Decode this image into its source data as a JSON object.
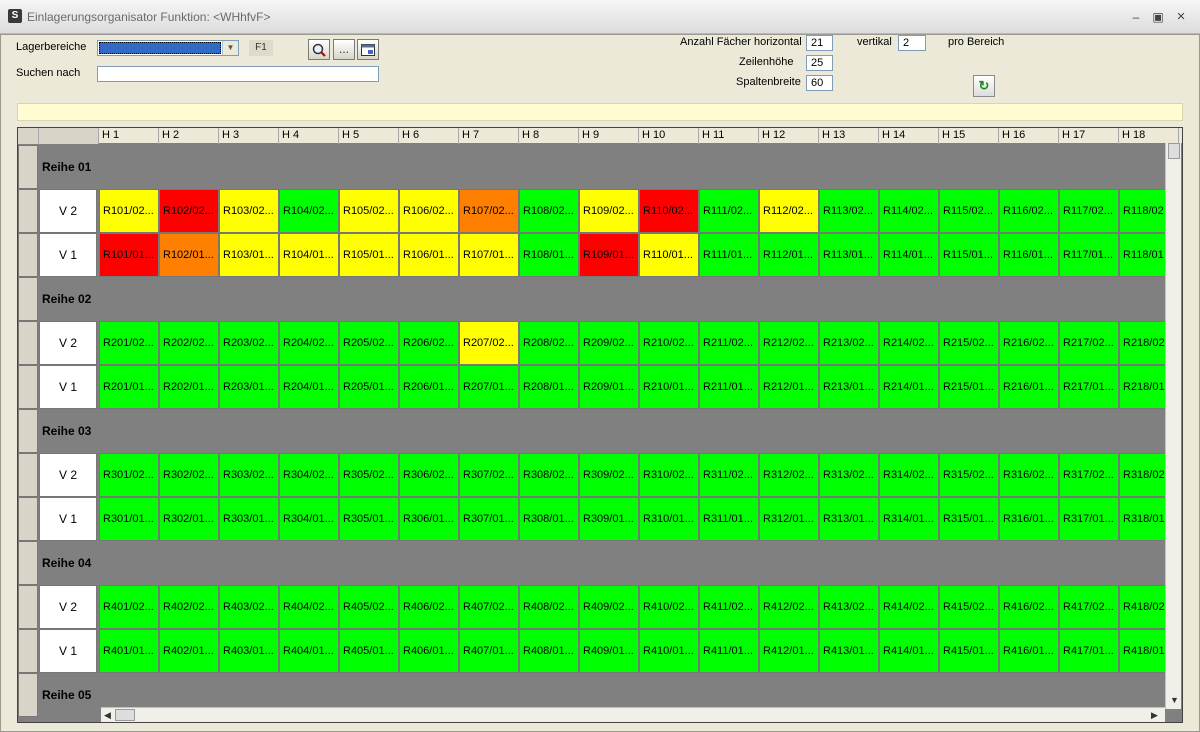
{
  "window": {
    "title": "Einlagerungsorganisator Funktion: <WHhfvF>",
    "app_icon": "S"
  },
  "toolbar": {
    "lagerbereiche_label": "Lagerbereiche",
    "lagerbereiche_value": "",
    "f1_label": "F1",
    "suchen_label": "Suchen nach",
    "suchen_value": "",
    "dots_label": "...",
    "anzahl_horizontal_label": "Anzahl Fächer horizontal",
    "anzahl_horizontal_value": "21",
    "vertikal_label": "vertikal",
    "vertikal_value": "2",
    "pro_bereich_label": "pro Bereich",
    "zeilenhoehe_label": "Zeilenhöhe",
    "zeilenhoehe_value": "25",
    "spaltenbreite_label": "Spaltenbreite",
    "spaltenbreite_value": "60"
  },
  "message_bar": "",
  "grid": {
    "columns": [
      "H 1",
      "H 2",
      "H 3",
      "H 4",
      "H 5",
      "H 6",
      "H 7",
      "H 8",
      "H 9",
      "H 10",
      "H 11",
      "H 12",
      "H 13",
      "H 14",
      "H 15",
      "H 16",
      "H 17",
      "H 18"
    ],
    "colors": {
      "green": "#00ff00",
      "yellow": "#ffff00",
      "red": "#ff0000",
      "orange": "#ff8000"
    },
    "sections": [
      {
        "label": "Reihe 01",
        "rows": [
          {
            "label": "V 2",
            "cells": [
              {
                "text": "R101/02...",
                "status": "yellow"
              },
              {
                "text": "R102/02...",
                "status": "red"
              },
              {
                "text": "R103/02...",
                "status": "yellow"
              },
              {
                "text": "R104/02...",
                "status": "green"
              },
              {
                "text": "R105/02...",
                "status": "yellow"
              },
              {
                "text": "R106/02...",
                "status": "yellow"
              },
              {
                "text": "R107/02...",
                "status": "orange"
              },
              {
                "text": "R108/02...",
                "status": "green"
              },
              {
                "text": "R109/02...",
                "status": "yellow"
              },
              {
                "text": "R110/02...",
                "status": "red"
              },
              {
                "text": "R111/02...",
                "status": "green"
              },
              {
                "text": "R112/02...",
                "status": "yellow"
              },
              {
                "text": "R113/02...",
                "status": "green"
              },
              {
                "text": "R114/02...",
                "status": "green"
              },
              {
                "text": "R115/02...",
                "status": "green"
              },
              {
                "text": "R116/02...",
                "status": "green"
              },
              {
                "text": "R117/02...",
                "status": "green"
              },
              {
                "text": "R118/02",
                "status": "green"
              }
            ]
          },
          {
            "label": "V 1",
            "cells": [
              {
                "text": "R101/01...",
                "status": "red"
              },
              {
                "text": "R102/01...",
                "status": "orange"
              },
              {
                "text": "R103/01...",
                "status": "yellow"
              },
              {
                "text": "R104/01...",
                "status": "yellow"
              },
              {
                "text": "R105/01...",
                "status": "yellow"
              },
              {
                "text": "R106/01...",
                "status": "yellow"
              },
              {
                "text": "R107/01...",
                "status": "yellow"
              },
              {
                "text": "R108/01...",
                "status": "green"
              },
              {
                "text": "R109/01...",
                "status": "red"
              },
              {
                "text": "R110/01...",
                "status": "yellow"
              },
              {
                "text": "R111/01...",
                "status": "green"
              },
              {
                "text": "R112/01...",
                "status": "green"
              },
              {
                "text": "R113/01...",
                "status": "green"
              },
              {
                "text": "R114/01...",
                "status": "green"
              },
              {
                "text": "R115/01...",
                "status": "green"
              },
              {
                "text": "R116/01...",
                "status": "green"
              },
              {
                "text": "R117/01...",
                "status": "green"
              },
              {
                "text": "R118/01",
                "status": "green"
              }
            ]
          }
        ]
      },
      {
        "label": "Reihe 02",
        "rows": [
          {
            "label": "V 2",
            "cells": [
              {
                "text": "R201/02...",
                "status": "green"
              },
              {
                "text": "R202/02...",
                "status": "green"
              },
              {
                "text": "R203/02...",
                "status": "green"
              },
              {
                "text": "R204/02...",
                "status": "green"
              },
              {
                "text": "R205/02...",
                "status": "green"
              },
              {
                "text": "R206/02...",
                "status": "green"
              },
              {
                "text": "R207/02...",
                "status": "yellow"
              },
              {
                "text": "R208/02...",
                "status": "green"
              },
              {
                "text": "R209/02...",
                "status": "green"
              },
              {
                "text": "R210/02...",
                "status": "green"
              },
              {
                "text": "R211/02...",
                "status": "green"
              },
              {
                "text": "R212/02...",
                "status": "green"
              },
              {
                "text": "R213/02...",
                "status": "green"
              },
              {
                "text": "R214/02...",
                "status": "green"
              },
              {
                "text": "R215/02...",
                "status": "green"
              },
              {
                "text": "R216/02...",
                "status": "green"
              },
              {
                "text": "R217/02...",
                "status": "green"
              },
              {
                "text": "R218/02",
                "status": "green"
              }
            ]
          },
          {
            "label": "V 1",
            "cells": [
              {
                "text": "R201/01...",
                "status": "green"
              },
              {
                "text": "R202/01...",
                "status": "green"
              },
              {
                "text": "R203/01...",
                "status": "green"
              },
              {
                "text": "R204/01...",
                "status": "green"
              },
              {
                "text": "R205/01...",
                "status": "green"
              },
              {
                "text": "R206/01...",
                "status": "green"
              },
              {
                "text": "R207/01...",
                "status": "green"
              },
              {
                "text": "R208/01...",
                "status": "green"
              },
              {
                "text": "R209/01...",
                "status": "green"
              },
              {
                "text": "R210/01...",
                "status": "green"
              },
              {
                "text": "R211/01...",
                "status": "green"
              },
              {
                "text": "R212/01...",
                "status": "green"
              },
              {
                "text": "R213/01...",
                "status": "green"
              },
              {
                "text": "R214/01...",
                "status": "green"
              },
              {
                "text": "R215/01...",
                "status": "green"
              },
              {
                "text": "R216/01...",
                "status": "green"
              },
              {
                "text": "R217/01...",
                "status": "green"
              },
              {
                "text": "R218/01",
                "status": "green"
              }
            ]
          }
        ]
      },
      {
        "label": "Reihe 03",
        "rows": [
          {
            "label": "V 2",
            "cells": [
              {
                "text": "R301/02...",
                "status": "green"
              },
              {
                "text": "R302/02...",
                "status": "green"
              },
              {
                "text": "R303/02...",
                "status": "green"
              },
              {
                "text": "R304/02...",
                "status": "green"
              },
              {
                "text": "R305/02...",
                "status": "green"
              },
              {
                "text": "R306/02...",
                "status": "green"
              },
              {
                "text": "R307/02...",
                "status": "green"
              },
              {
                "text": "R308/02...",
                "status": "green"
              },
              {
                "text": "R309/02...",
                "status": "green"
              },
              {
                "text": "R310/02...",
                "status": "green"
              },
              {
                "text": "R311/02...",
                "status": "green"
              },
              {
                "text": "R312/02...",
                "status": "green"
              },
              {
                "text": "R313/02...",
                "status": "green"
              },
              {
                "text": "R314/02...",
                "status": "green"
              },
              {
                "text": "R315/02...",
                "status": "green"
              },
              {
                "text": "R316/02...",
                "status": "green"
              },
              {
                "text": "R317/02...",
                "status": "green"
              },
              {
                "text": "R318/02",
                "status": "green"
              }
            ]
          },
          {
            "label": "V 1",
            "cells": [
              {
                "text": "R301/01...",
                "status": "green"
              },
              {
                "text": "R302/01...",
                "status": "green"
              },
              {
                "text": "R303/01...",
                "status": "green"
              },
              {
                "text": "R304/01...",
                "status": "green"
              },
              {
                "text": "R305/01...",
                "status": "green"
              },
              {
                "text": "R306/01...",
                "status": "green"
              },
              {
                "text": "R307/01...",
                "status": "green"
              },
              {
                "text": "R308/01...",
                "status": "green"
              },
              {
                "text": "R309/01...",
                "status": "green"
              },
              {
                "text": "R310/01...",
                "status": "green"
              },
              {
                "text": "R311/01...",
                "status": "green"
              },
              {
                "text": "R312/01...",
                "status": "green"
              },
              {
                "text": "R313/01...",
                "status": "green"
              },
              {
                "text": "R314/01...",
                "status": "green"
              },
              {
                "text": "R315/01...",
                "status": "green"
              },
              {
                "text": "R316/01...",
                "status": "green"
              },
              {
                "text": "R317/01...",
                "status": "green"
              },
              {
                "text": "R318/01",
                "status": "green"
              }
            ]
          }
        ]
      },
      {
        "label": "Reihe 04",
        "rows": [
          {
            "label": "V 2",
            "cells": [
              {
                "text": "R401/02...",
                "status": "green"
              },
              {
                "text": "R402/02...",
                "status": "green"
              },
              {
                "text": "R403/02...",
                "status": "green"
              },
              {
                "text": "R404/02...",
                "status": "green"
              },
              {
                "text": "R405/02...",
                "status": "green"
              },
              {
                "text": "R406/02...",
                "status": "green"
              },
              {
                "text": "R407/02...",
                "status": "green"
              },
              {
                "text": "R408/02...",
                "status": "green"
              },
              {
                "text": "R409/02...",
                "status": "green"
              },
              {
                "text": "R410/02...",
                "status": "green"
              },
              {
                "text": "R411/02...",
                "status": "green"
              },
              {
                "text": "R412/02...",
                "status": "green"
              },
              {
                "text": "R413/02...",
                "status": "green"
              },
              {
                "text": "R414/02...",
                "status": "green"
              },
              {
                "text": "R415/02...",
                "status": "green"
              },
              {
                "text": "R416/02...",
                "status": "green"
              },
              {
                "text": "R417/02...",
                "status": "green"
              },
              {
                "text": "R418/02",
                "status": "green"
              }
            ]
          },
          {
            "label": "V 1",
            "cells": [
              {
                "text": "R401/01...",
                "status": "green"
              },
              {
                "text": "R402/01...",
                "status": "green"
              },
              {
                "text": "R403/01...",
                "status": "green"
              },
              {
                "text": "R404/01...",
                "status": "green"
              },
              {
                "text": "R405/01...",
                "status": "green"
              },
              {
                "text": "R406/01...",
                "status": "green"
              },
              {
                "text": "R407/01...",
                "status": "green"
              },
              {
                "text": "R408/01...",
                "status": "green"
              },
              {
                "text": "R409/01...",
                "status": "green"
              },
              {
                "text": "R410/01...",
                "status": "green"
              },
              {
                "text": "R411/01...",
                "status": "green"
              },
              {
                "text": "R412/01...",
                "status": "green"
              },
              {
                "text": "R413/01...",
                "status": "green"
              },
              {
                "text": "R414/01...",
                "status": "green"
              },
              {
                "text": "R415/01...",
                "status": "green"
              },
              {
                "text": "R416/01...",
                "status": "green"
              },
              {
                "text": "R417/01...",
                "status": "green"
              },
              {
                "text": "R418/01",
                "status": "green"
              }
            ]
          }
        ]
      },
      {
        "label": "Reihe 05",
        "rows": []
      }
    ]
  }
}
